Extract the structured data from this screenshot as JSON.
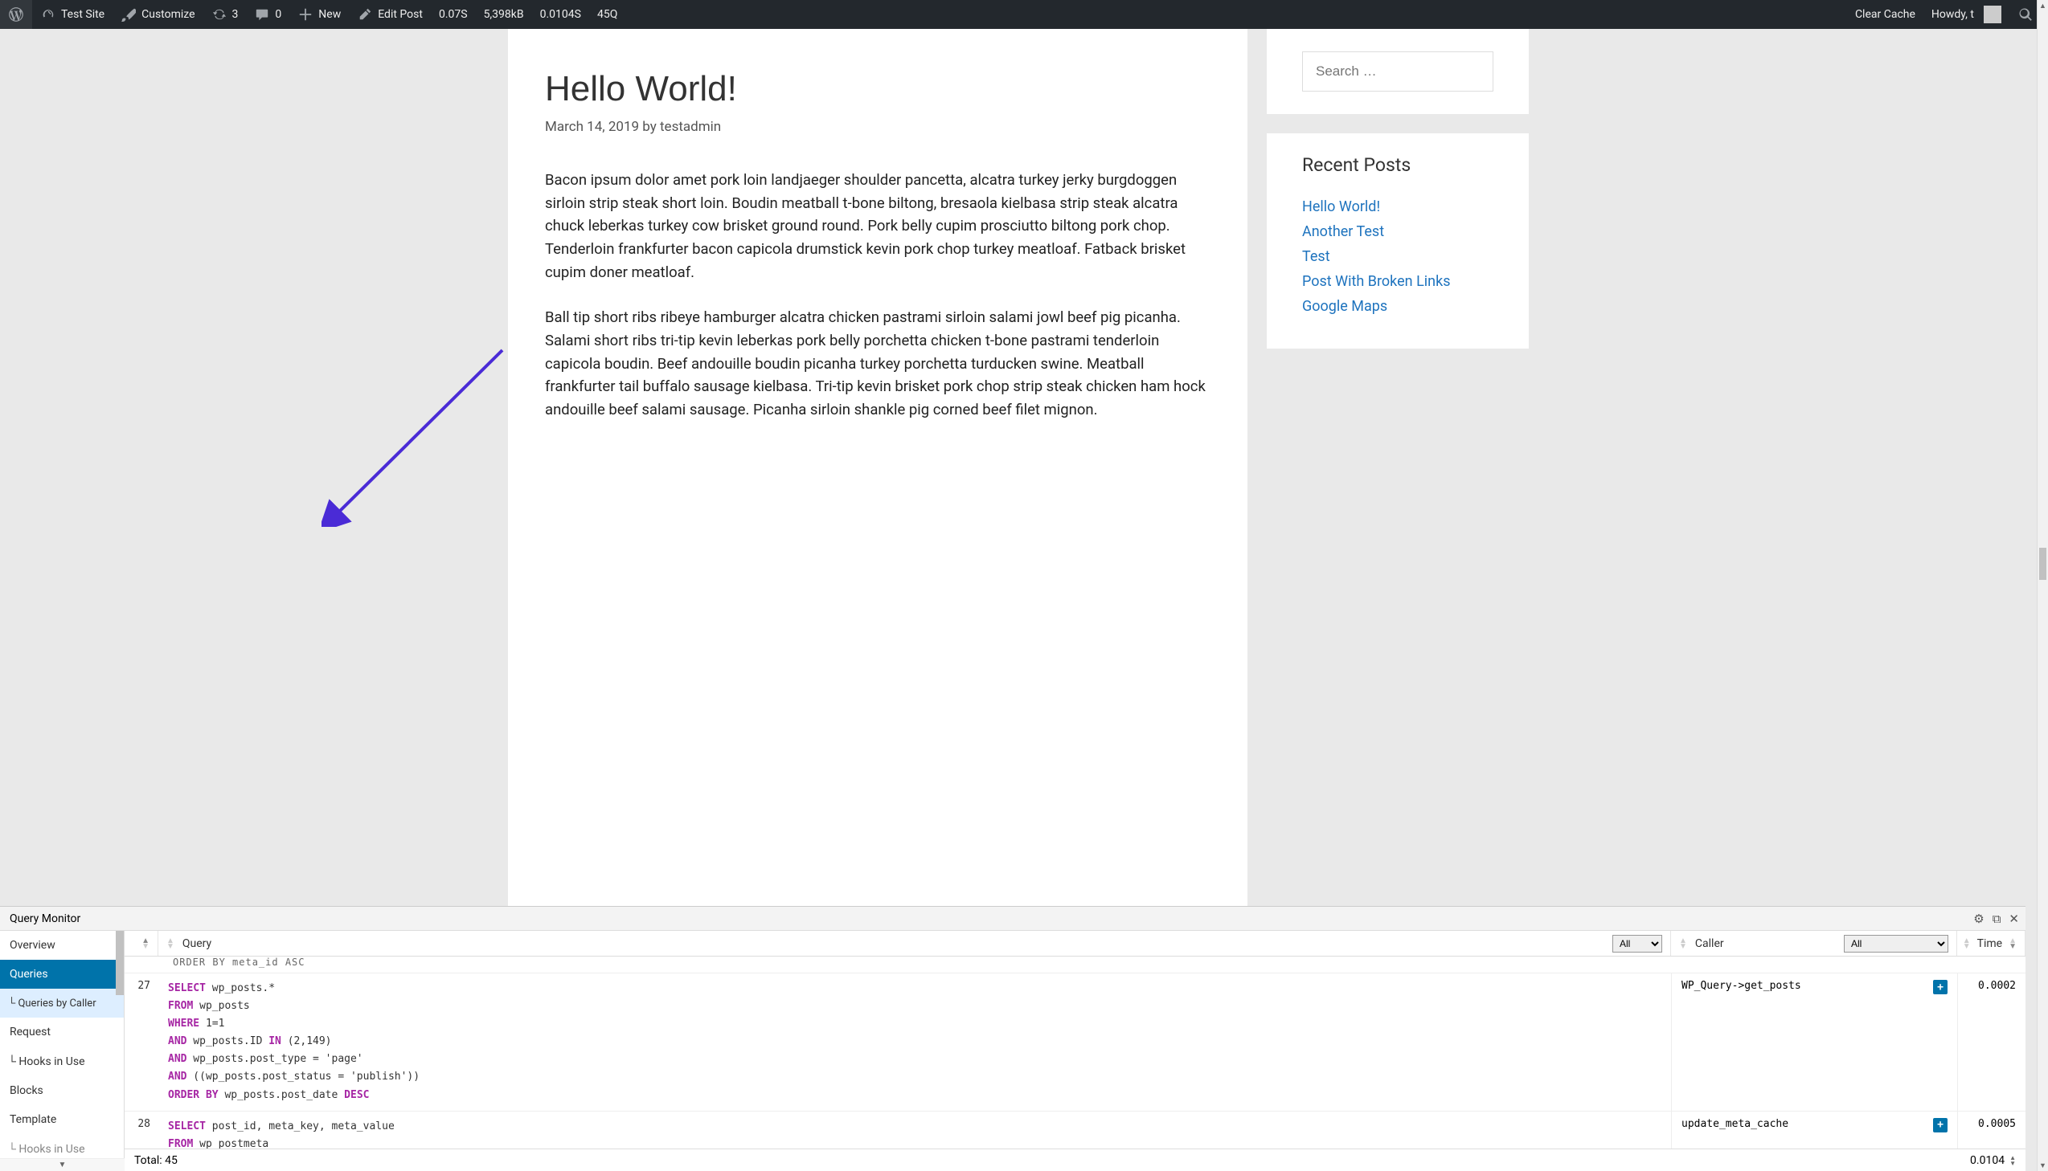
{
  "adminbar": {
    "site_name": "Test Site",
    "customize": "Customize",
    "updates_count": "3",
    "comments_count": "0",
    "new": "New",
    "edit_post": "Edit Post",
    "qm_time": "0.07S",
    "qm_mem": "5,398kB",
    "qm_dbtime": "0.0104S",
    "qm_queries": "45Q",
    "clear_cache": "Clear Cache",
    "howdy": "Howdy, t"
  },
  "post": {
    "title": "Hello World!",
    "meta": "March 14, 2019 by testadmin",
    "p1": "Bacon ipsum dolor amet pork loin landjaeger shoulder pancetta, alcatra turkey jerky burgdoggen sirloin strip steak short loin. Boudin meatball t-bone biltong, bresaola kielbasa strip steak alcatra chuck leberkas turkey cow brisket ground round. Pork belly cupim prosciutto biltong pork chop. Tenderloin frankfurter bacon capicola drumstick kevin pork chop turkey meatloaf. Fatback brisket cupim doner meatloaf.",
    "p2": "Ball tip short ribs ribeye hamburger alcatra chicken pastrami sirloin salami jowl beef pig picanha. Salami short ribs tri-tip kevin leberkas pork belly porchetta chicken t-bone pastrami tenderloin capicola boudin. Beef andouille boudin picanha turkey porchetta turducken swine. Meatball frankfurter tail buffalo sausage kielbasa. Tri-tip kevin brisket pork chop strip steak chicken ham hock andouille beef salami sausage. Picanha sirloin shankle pig corned beef filet mignon."
  },
  "search": {
    "placeholder": "Search …"
  },
  "recent": {
    "title": "Recent Posts",
    "items": [
      "Hello World!",
      "Another Test",
      "Test",
      "Post With Broken Links",
      "Google Maps"
    ]
  },
  "qm": {
    "title": "Query Monitor",
    "sidebar": {
      "overview": "Overview",
      "queries": "Queries",
      "queries_by_caller": "Queries by Caller",
      "request": "Request",
      "hooks_in_use": "Hooks in Use",
      "blocks": "Blocks",
      "template": "Template",
      "hooks_bottom": "Hooks in Use"
    },
    "cols": {
      "num": "#",
      "query": "Query",
      "caller": "Caller",
      "time": "Time",
      "filter_all": "All"
    },
    "prev_tail": "ORDER BY meta_id ASC",
    "rows": [
      {
        "n": "27",
        "sql_html": "<span class='qm-kw'>SELECT</span> wp_posts.*\n<span class='qm-kw'>FROM</span> wp_posts\n<span class='qm-kw'>WHERE</span> 1=1\n<span class='qm-kw'>AND</span> wp_posts.ID <span class='qm-kw'>IN</span> (2,149)\n<span class='qm-kw'>AND</span> wp_posts.post_type = 'page'\n<span class='qm-kw'>AND</span> ((wp_posts.post_status = 'publish'))\n<span class='qm-kw'>ORDER BY</span> wp_posts.post_date <span class='qm-kw'>DESC</span>",
        "caller": "WP_Query->get_posts",
        "time": "0.0002"
      },
      {
        "n": "28",
        "sql_html": "<span class='qm-kw'>SELECT</span> post_id, meta_key, meta_value\n<span class='qm-kw'>FROM</span> wp_postmeta",
        "caller": "update_meta_cache",
        "time": "0.0005"
      }
    ],
    "footer": {
      "total": "Total: 45",
      "time": "0.0104"
    }
  }
}
